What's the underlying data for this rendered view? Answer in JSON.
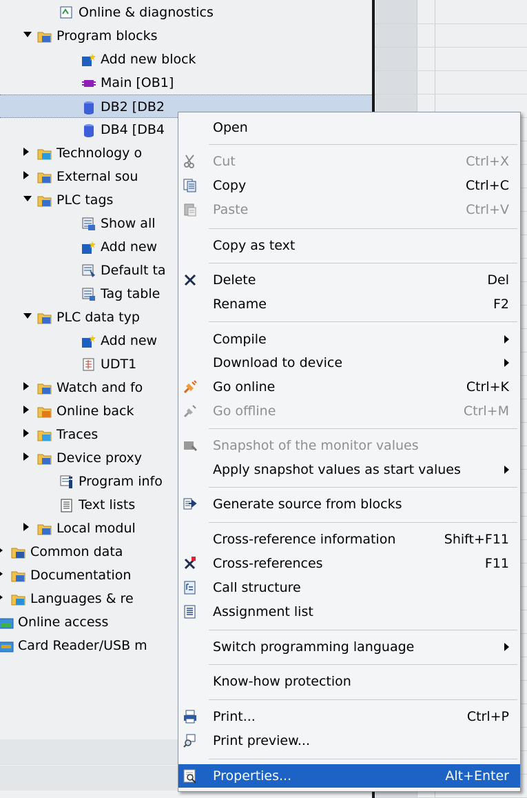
{
  "tree": {
    "items": [
      {
        "label": "Online & diagnostics",
        "icon": "diagnostics-icon",
        "expander": "none"
      },
      {
        "label": "Program blocks",
        "icon": "program-blocks-folder-icon",
        "expander": "expanded"
      },
      {
        "label": "Add new block",
        "icon": "add-new-icon",
        "expander": "none"
      },
      {
        "label": "Main [OB1]",
        "icon": "ob-block-icon",
        "expander": "none"
      },
      {
        "label": "DB2 [DB2",
        "icon": "db-block-icon",
        "expander": "none",
        "selected": true
      },
      {
        "label": "DB4 [DB4",
        "icon": "db-block-icon",
        "expander": "none"
      },
      {
        "label": "Technology o",
        "icon": "technology-folder-icon",
        "expander": "collapsed"
      },
      {
        "label": "External sou",
        "icon": "external-sources-folder-icon",
        "expander": "collapsed"
      },
      {
        "label": "PLC tags",
        "icon": "plc-tags-folder-icon",
        "expander": "expanded"
      },
      {
        "label": "Show all",
        "icon": "show-all-tags-icon",
        "expander": "none"
      },
      {
        "label": "Add new",
        "icon": "add-new-icon",
        "expander": "none"
      },
      {
        "label": "Default ta",
        "icon": "default-tag-table-icon",
        "expander": "none"
      },
      {
        "label": "Tag table",
        "icon": "tag-table-icon",
        "expander": "none"
      },
      {
        "label": "PLC data typ",
        "icon": "plc-data-types-folder-icon",
        "expander": "expanded"
      },
      {
        "label": "Add new",
        "icon": "add-new-icon",
        "expander": "none"
      },
      {
        "label": "UDT1",
        "icon": "udt-icon",
        "expander": "none"
      },
      {
        "label": "Watch and fo",
        "icon": "watch-tables-folder-icon",
        "expander": "collapsed"
      },
      {
        "label": "Online back",
        "icon": "online-backups-folder-icon",
        "expander": "collapsed"
      },
      {
        "label": "Traces",
        "icon": "traces-folder-icon",
        "expander": "collapsed"
      },
      {
        "label": "Device proxy",
        "icon": "device-proxy-folder-icon",
        "expander": "collapsed"
      },
      {
        "label": "Program info",
        "icon": "program-info-icon",
        "expander": "none"
      },
      {
        "label": "Text lists",
        "icon": "text-lists-icon",
        "expander": "none"
      },
      {
        "label": "Local modul",
        "icon": "local-modules-folder-icon",
        "expander": "collapsed"
      },
      {
        "label": "Common data",
        "icon": "common-data-folder-icon",
        "expander": "collapsed"
      },
      {
        "label": "Documentation",
        "icon": "documentation-folder-icon",
        "expander": "collapsed"
      },
      {
        "label": "Languages & re",
        "icon": "languages-folder-icon",
        "expander": "collapsed"
      },
      {
        "label": "Online access",
        "icon": "online-access-icon",
        "expander": "none"
      },
      {
        "label": "Card Reader/USB m",
        "icon": "card-reader-icon",
        "expander": "none"
      }
    ]
  },
  "menu": {
    "items": [
      {
        "label": "Open",
        "shortcut": "",
        "icon": "",
        "disabled": false,
        "submenu": false
      },
      {
        "label": "Cut",
        "shortcut": "Ctrl+X",
        "icon": "scissors-icon",
        "disabled": true,
        "submenu": false
      },
      {
        "label": "Copy",
        "shortcut": "Ctrl+C",
        "icon": "copy-icon",
        "disabled": false,
        "submenu": false
      },
      {
        "label": "Paste",
        "shortcut": "Ctrl+V",
        "icon": "paste-icon",
        "disabled": true,
        "submenu": false
      },
      {
        "label": "Copy as text",
        "shortcut": "",
        "icon": "",
        "disabled": false,
        "submenu": false
      },
      {
        "label": "Delete",
        "shortcut": "Del",
        "icon": "delete-x-icon",
        "disabled": false,
        "submenu": false
      },
      {
        "label": "Rename",
        "shortcut": "F2",
        "icon": "",
        "disabled": false,
        "submenu": false
      },
      {
        "label": "Compile",
        "shortcut": "",
        "icon": "",
        "disabled": false,
        "submenu": true
      },
      {
        "label": "Download to device",
        "shortcut": "",
        "icon": "",
        "disabled": false,
        "submenu": true
      },
      {
        "label": "Go online",
        "shortcut": "Ctrl+K",
        "icon": "go-online-icon",
        "disabled": false,
        "submenu": false
      },
      {
        "label": "Go offline",
        "shortcut": "Ctrl+M",
        "icon": "go-offline-icon",
        "disabled": true,
        "submenu": false
      },
      {
        "label": "Snapshot of the monitor values",
        "shortcut": "",
        "icon": "snapshot-icon",
        "disabled": true,
        "submenu": false
      },
      {
        "label": "Apply snapshot values as start values",
        "shortcut": "",
        "icon": "",
        "disabled": false,
        "submenu": true
      },
      {
        "label": "Generate source from blocks",
        "shortcut": "",
        "icon": "generate-source-icon",
        "disabled": false,
        "submenu": false
      },
      {
        "label": "Cross-reference information",
        "shortcut": "Shift+F11",
        "icon": "",
        "disabled": false,
        "submenu": false
      },
      {
        "label": "Cross-references",
        "shortcut": "F11",
        "icon": "cross-references-icon",
        "disabled": false,
        "submenu": false
      },
      {
        "label": "Call structure",
        "shortcut": "",
        "icon": "call-structure-icon",
        "disabled": false,
        "submenu": false
      },
      {
        "label": "Assignment list",
        "shortcut": "",
        "icon": "assignment-list-icon",
        "disabled": false,
        "submenu": false
      },
      {
        "label": "Switch programming language",
        "shortcut": "",
        "icon": "",
        "disabled": false,
        "submenu": true
      },
      {
        "label": "Know-how protection",
        "shortcut": "",
        "icon": "",
        "disabled": false,
        "submenu": false
      },
      {
        "label": "Print...",
        "shortcut": "Ctrl+P",
        "icon": "print-icon",
        "disabled": false,
        "submenu": false
      },
      {
        "label": "Print preview...",
        "shortcut": "",
        "icon": "print-preview-icon",
        "disabled": false,
        "submenu": false
      },
      {
        "label": "Properties...",
        "shortcut": "Alt+Enter",
        "icon": "properties-icon",
        "disabled": false,
        "submenu": false,
        "highlighted": true
      }
    ]
  },
  "colors": {
    "highlight": "#1d63c6",
    "selection": "#c9d7eb",
    "menu_background": "#f4f5f7",
    "disabled_text": "#8c8f93"
  }
}
